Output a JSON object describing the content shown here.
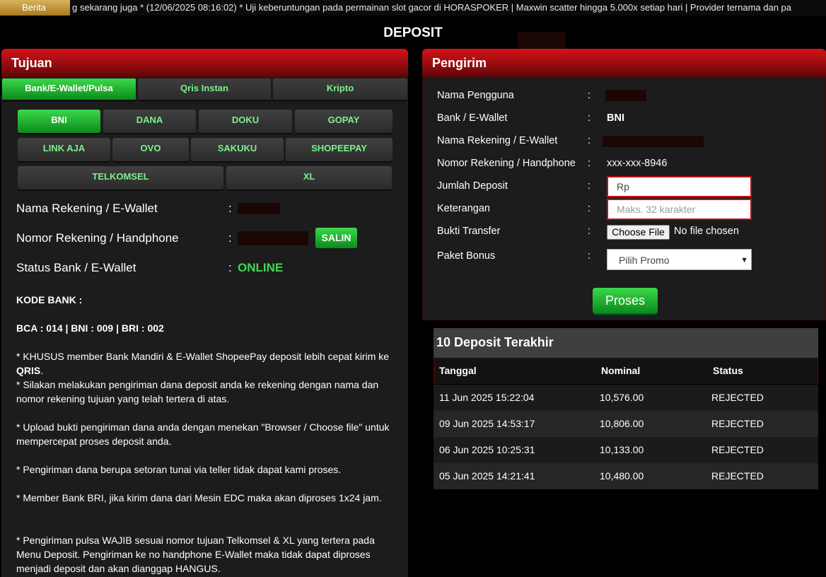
{
  "ticker": {
    "badge": "Berita",
    "text": "g sekarang juga *   (12/06/2025 08:16:02) * Uji keberuntungan pada permainan slot gacor di HORASPOKER | Maxwin scatter hingga 5.000x setiap hari | Provider ternama dan pa"
  },
  "page_title": "DEPOSIT",
  "tujuan": {
    "title": "Tujuan",
    "tabs": [
      {
        "label": "Bank/E-Wallet/Pulsa",
        "active": true
      },
      {
        "label": "Qris Instan",
        "active": false
      },
      {
        "label": "Kripto",
        "active": false
      }
    ],
    "banks": [
      "BNI",
      "DANA",
      "DOKU",
      "GOPAY",
      "LINK AJA",
      "OVO",
      "SAKUKU",
      "SHOPEEPAY",
      "TELKOMSEL",
      "XL"
    ],
    "selected_bank": "BNI",
    "fields": {
      "nama_label": "Nama Rekening / E-Wallet",
      "nomor_label": "Nomor Rekening / Handphone",
      "status_label": "Status Bank / E-Wallet",
      "colon": ":",
      "status_value": "ONLINE",
      "salin_label": "SALIN"
    },
    "notes": {
      "kode_title": "KODE BANK :",
      "kode_values": "BCA : 014 | BNI : 009 | BRI : 002",
      "n1_pre": "* KHUSUS member Bank Mandiri & E-Wallet ShopeePay deposit lebih cepat kirim ke ",
      "n1_bold": "QRIS",
      "n1_post": ".",
      "n2": "* Silakan melakukan pengiriman dana deposit anda ke rekening dengan nama dan nomor rekening tujuan yang telah tertera di atas.",
      "n3": "* Upload bukti pengiriman dana anda dengan menekan \"Browser / Choose file\" untuk mempercepat proses deposit anda.",
      "n4": "* Pengiriman dana berupa setoran tunai via teller tidak dapat kami proses.",
      "n5": "* Member Bank BRI, jika kirim dana dari Mesin EDC maka akan diproses 1x24 jam.",
      "n6": "* Pengiriman pulsa WAJIB sesuai nomor tujuan Telkomsel & XL yang tertera pada Menu Deposit. Pengiriman ke no handphone E-Wallet maka tidak dapat diproses menjadi deposit dan akan dianggap HANGUS."
    }
  },
  "pengirim": {
    "title": "Pengirim",
    "colon": ":",
    "labels": {
      "nama_pengguna": "Nama Pengguna",
      "bank": "Bank / E-Wallet",
      "nama_rekening": "Nama Rekening / E-Wallet",
      "nomor_rekening": "Nomor Rekening / Handphone",
      "jumlah": "Jumlah Deposit",
      "keterangan": "Keterangan",
      "bukti": "Bukti Transfer",
      "paket": "Paket Bonus"
    },
    "bank_value": "BNI",
    "nomor_value": "xxx-xxx-8946",
    "jumlah_value": "Rp",
    "keterangan_placeholder": "Maks. 32 karakter",
    "choose_file_label": "Choose File",
    "no_file_text": "No file chosen",
    "paket_selected": "Pilih Promo",
    "proses_label": "Proses"
  },
  "recent": {
    "title": "10 Deposit Terakhir",
    "columns": [
      "Tanggal",
      "Nominal",
      "Status"
    ],
    "rows": [
      [
        "11 Jun 2025 15:22:04",
        "10,576.00",
        "REJECTED"
      ],
      [
        "09 Jun 2025 14:53:17",
        "10,806.00",
        "REJECTED"
      ],
      [
        "06 Jun 2025 10:25:31",
        "10,133.00",
        "REJECTED"
      ],
      [
        "05 Jun 2025 14:21:41",
        "10,480.00",
        "REJECTED"
      ]
    ]
  },
  "colors": {
    "accent_green": "#3fd74e",
    "header_red": "#d41218",
    "panel_bg": "#1c1c1c"
  }
}
